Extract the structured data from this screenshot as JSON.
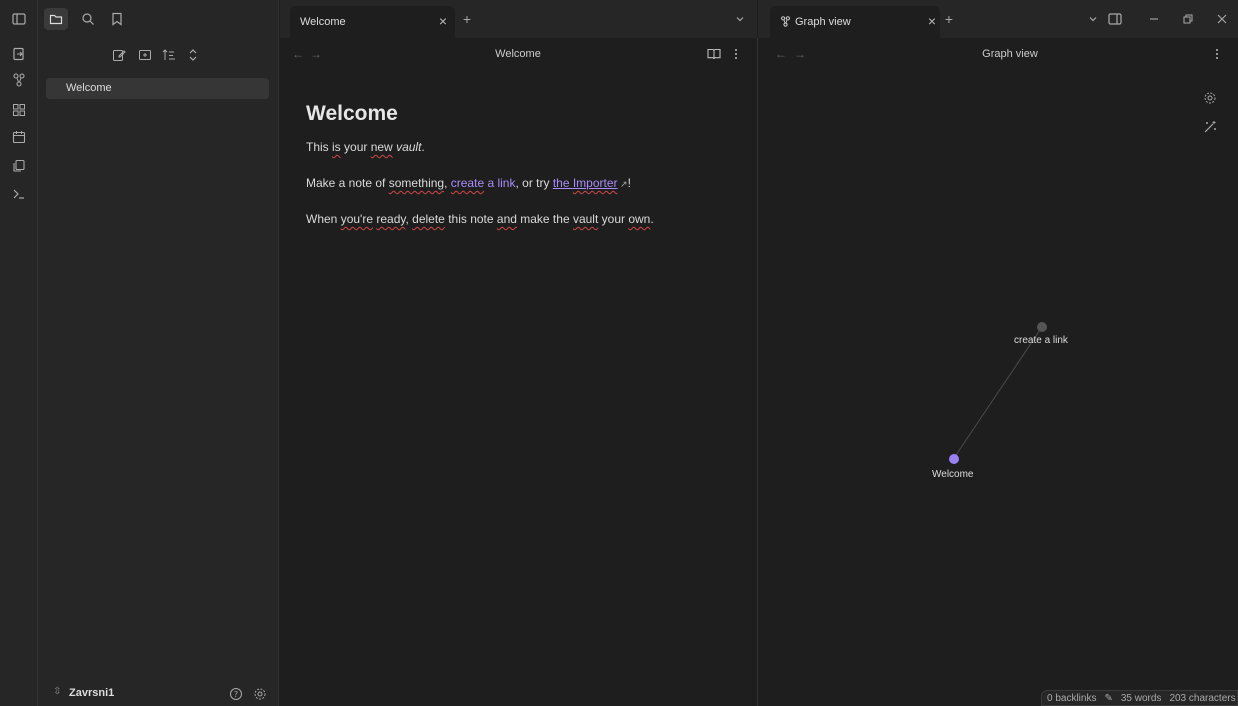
{
  "ribbon": {
    "icons": [
      "sidebar-toggle-icon",
      "open-quick-switcher-icon",
      "graph-view-icon",
      "canvas-icon",
      "daily-note-icon",
      "templates-icon",
      "command-palette-icon"
    ]
  },
  "sidebar": {
    "tabs": [
      "files-icon",
      "search-icon",
      "bookmarks-icon"
    ],
    "actions": [
      "new-note-icon",
      "new-folder-icon",
      "sort-icon",
      "collapse-icon"
    ],
    "files": [
      {
        "label": "Welcome"
      }
    ],
    "vault": {
      "name": "Zavrsni1"
    }
  },
  "left_tabbar": {
    "tab_label": "Welcome",
    "new_tab": "+",
    "dropdown": "⌄"
  },
  "right_tabbar": {
    "tab_label": "Graph view",
    "new_tab": "+",
    "dropdown": "⌄"
  },
  "left_pane": {
    "title": "Welcome",
    "note": {
      "heading": "Welcome",
      "line1_a": "This ",
      "line1_b": "is",
      "line1_c": " your ",
      "line1_d": "new",
      "line1_e": " ",
      "line1_f": "vault",
      "line1_g": ".",
      "line2_a": "Make a note of ",
      "line2_b": "something",
      "line2_c": ", ",
      "line2_d": "create",
      "line2_e": " a link",
      "line2_f": ", or try ",
      "line2_g": "the ",
      "line2_h": "Importer",
      "line2_i": "!",
      "line3_a": "When ",
      "line3_b": "you're",
      "line3_c": " ",
      "line3_d": "ready",
      "line3_e": ", ",
      "line3_f": "delete",
      "line3_g": " this note ",
      "line3_h": "and",
      "line3_i": " make the ",
      "line3_j": "vault",
      "line3_k": " your ",
      "line3_l": "own",
      "line3_m": "."
    }
  },
  "right_pane": {
    "title": "Graph view",
    "nodes": [
      {
        "label": "create a link",
        "color": "#555555"
      },
      {
        "label": "Welcome",
        "color": "#9b80f4"
      }
    ]
  },
  "status_bar": {
    "backlinks": "0 backlinks",
    "words": "35 words",
    "characters": "203 characters"
  },
  "colors": {
    "accent": "#a88bfa",
    "background": "#1e1e1e",
    "sidebar": "#262626"
  }
}
